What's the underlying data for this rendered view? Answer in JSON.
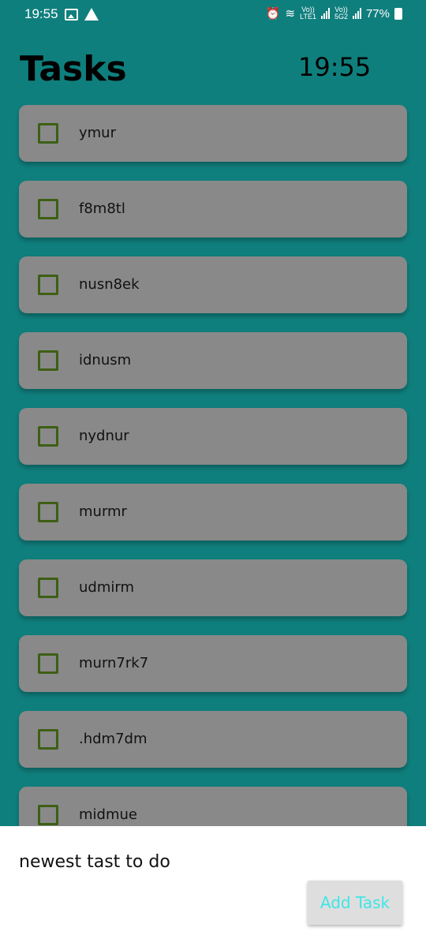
{
  "status_bar": {
    "time": "19:55",
    "net1_top": "Vo))",
    "net1_bottom": "LTE1",
    "net2_top": "Vo))",
    "net2_bottom": "5G2",
    "battery": "77%"
  },
  "header": {
    "title": "Tasks",
    "clock": "19:55"
  },
  "tasks": [
    {
      "label": "ymur",
      "checked": false
    },
    {
      "label": "f8m8tl",
      "checked": false
    },
    {
      "label": "nusn8ek",
      "checked": false
    },
    {
      "label": "idnusm",
      "checked": false
    },
    {
      "label": "nydnur",
      "checked": false
    },
    {
      "label": "murmr",
      "checked": false
    },
    {
      "label": "udmirm",
      "checked": false
    },
    {
      "label": "murn7rk7",
      "checked": false
    },
    {
      "label": ".hdm7dm",
      "checked": false
    },
    {
      "label": "midmue",
      "checked": false
    }
  ],
  "input": {
    "value": "newest tast to do"
  },
  "add_button": {
    "label": "Add Task"
  },
  "colors": {
    "background": "#0f7f7d",
    "card": "#898989",
    "checkbox_border": "#3d5f14",
    "button_text": "#3ee6e6"
  }
}
